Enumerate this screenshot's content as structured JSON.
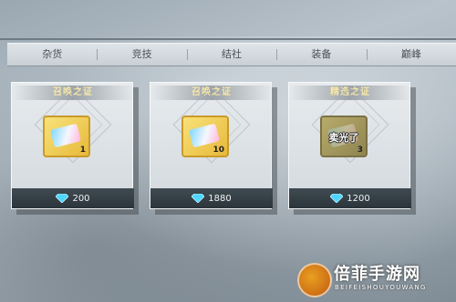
{
  "tabs": [
    "杂货",
    "竞技",
    "结社",
    "装备",
    "巅峰"
  ],
  "cards": [
    {
      "title": "召唤之证",
      "quantity": "1",
      "price": "200",
      "sold_out": "",
      "item_style": "gold"
    },
    {
      "title": "召唤之证",
      "quantity": "10",
      "price": "1880",
      "sold_out": "",
      "item_style": "gold"
    },
    {
      "title": "精选之证",
      "quantity": "3",
      "price": "1200",
      "sold_out": "卖光了",
      "item_style": "olive"
    }
  ],
  "currency_icon": "diamond-icon",
  "watermark": {
    "title": "倍菲手游网",
    "subtitle": "BEIFEISHOUYOUWANG"
  },
  "colors": {
    "title_text": "#f6e6a8",
    "price_bar": "#2c353c",
    "gem": "#4fd6ff"
  }
}
